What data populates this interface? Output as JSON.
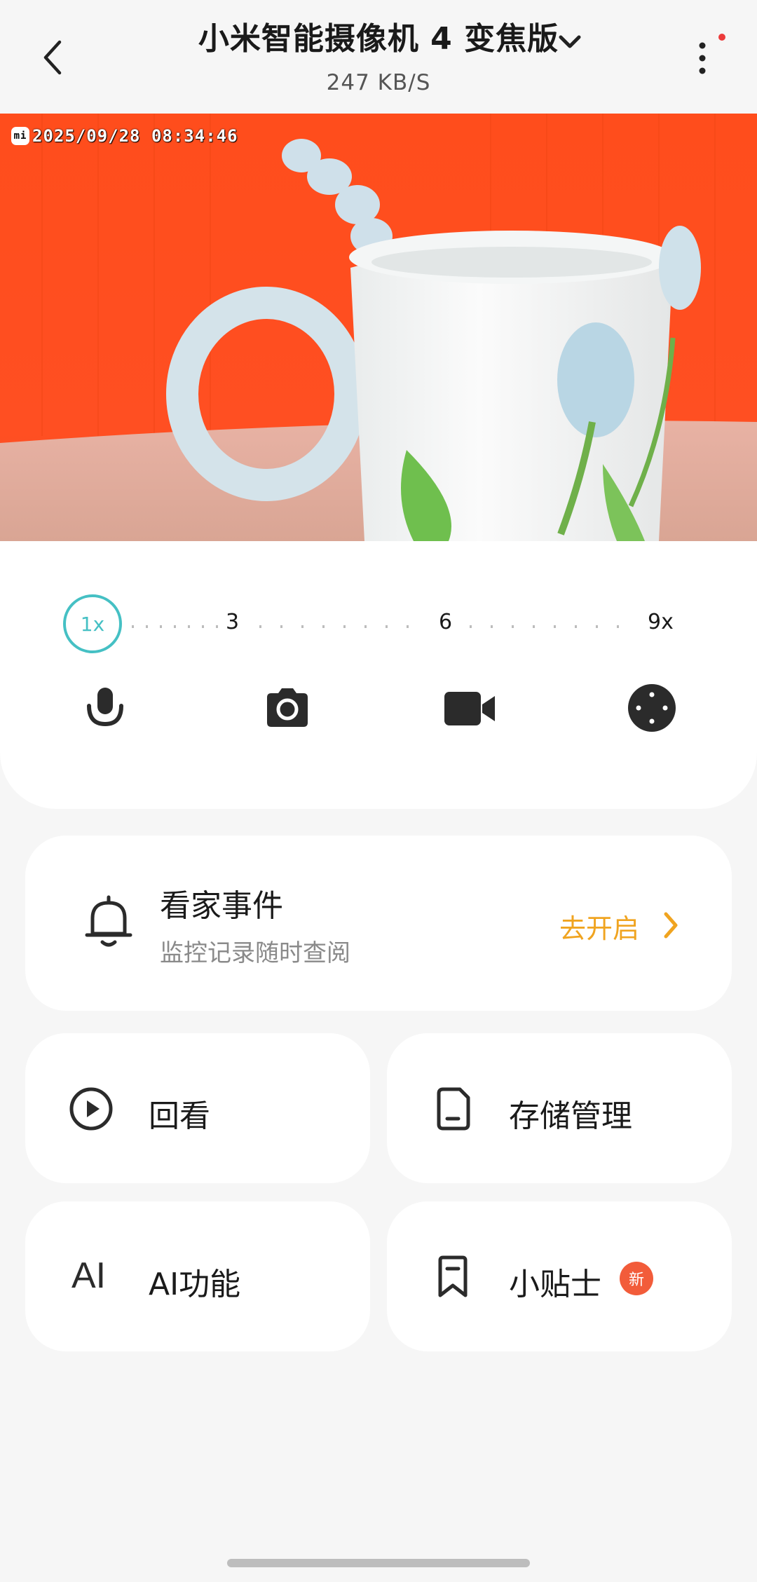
{
  "header": {
    "title": "小米智能摄像机 4 变焦版",
    "bitrate": "247 KB/S"
  },
  "video": {
    "timestamp": "2025/09/28  08:34:46",
    "logo_text": "mi"
  },
  "zoom": {
    "current": "1x",
    "marks": [
      "3",
      "6",
      "9x"
    ],
    "accent_color": "#45c0c4"
  },
  "controls": {
    "icons": [
      "microphone-icon",
      "camera-icon",
      "video-record-icon",
      "direction-pad-icon"
    ]
  },
  "event_card": {
    "title": "看家事件",
    "subtitle": "监控记录随时查阅",
    "action": "去开启",
    "action_color": "#f0a420"
  },
  "tiles": [
    {
      "label": "回看",
      "icon": "play-circle-icon"
    },
    {
      "label": "存储管理",
      "icon": "storage-icon"
    },
    {
      "label": "AI功能",
      "icon": "ai-icon",
      "icon_text": "AI"
    },
    {
      "label": "小贴士",
      "icon": "bookmark-icon",
      "badge": "新"
    }
  ]
}
